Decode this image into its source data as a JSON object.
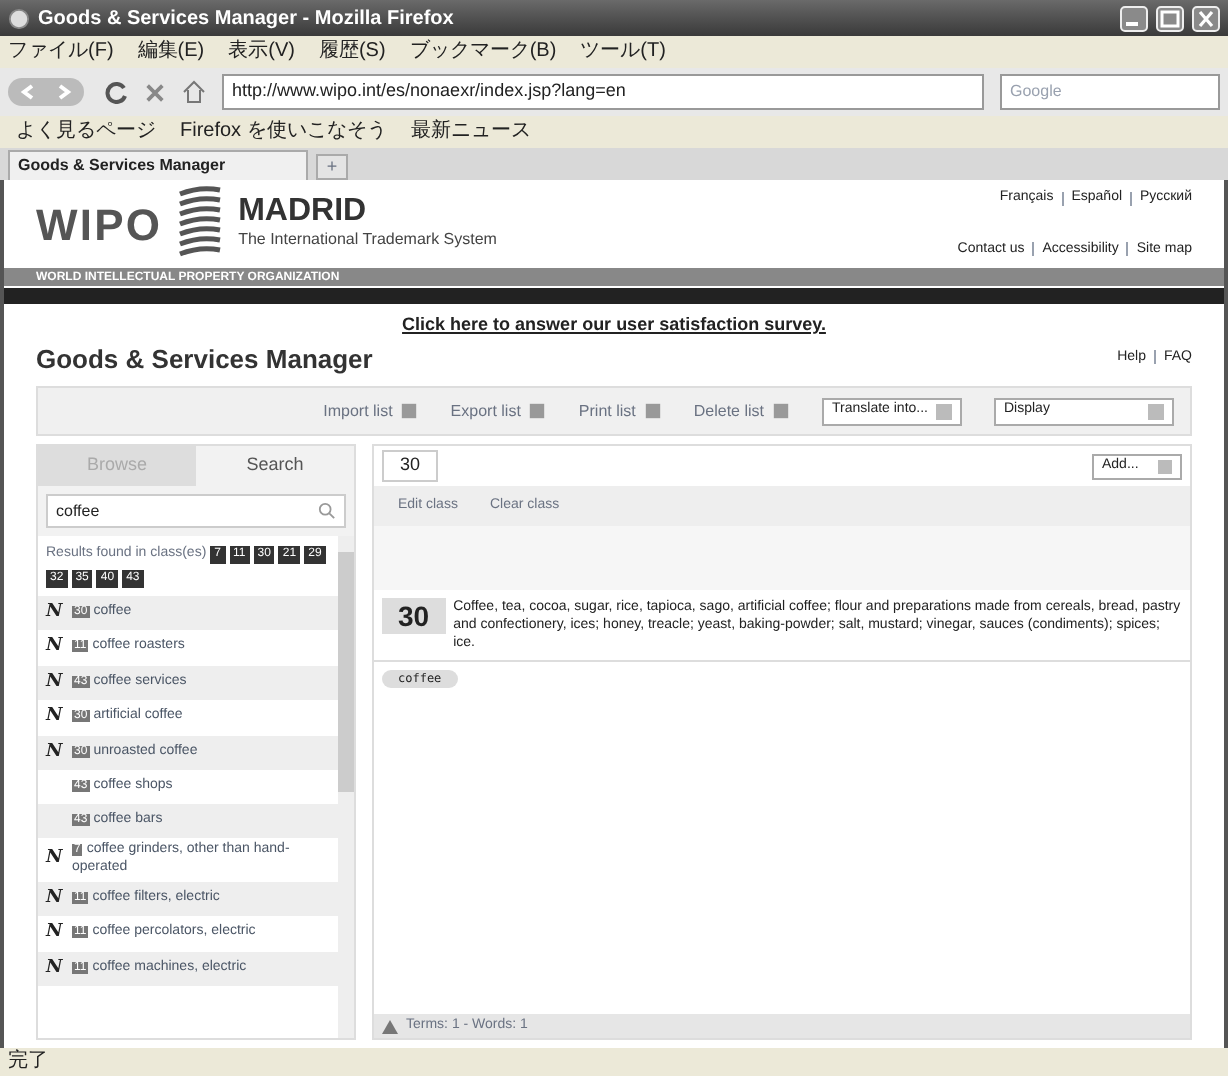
{
  "window": {
    "title": "Goods & Services Manager - Mozilla Firefox"
  },
  "menu": [
    "ファイル(F)",
    "編集(E)",
    "表示(V)",
    "履歴(S)",
    "ブックマーク(B)",
    "ツール(T)"
  ],
  "address": {
    "value": "http://www.wipo.int/es/nonaexr/index.jsp?lang=en"
  },
  "search_engine": {
    "placeholder": "Google"
  },
  "bookmarks": [
    "よく見るページ",
    "Firefox を使いこなそう",
    "最新ニュース"
  ],
  "tab": {
    "title": "Goods & Services Manager",
    "new_tab": "+"
  },
  "header": {
    "wipo": "WIPO",
    "madrid": "MADRID",
    "subtitle": "The International Trademark System",
    "org": "WORLD INTELLECTUAL PROPERTY ORGANIZATION",
    "languages": [
      "Français",
      "Español",
      "Русский"
    ],
    "links": [
      "Contact us",
      "Accessibility",
      "Site map"
    ]
  },
  "survey_link": "Click here to answer our user satisfaction survey.",
  "page_title": "Goods & Services Manager",
  "help_links": [
    "Help",
    "FAQ"
  ],
  "toolbar": {
    "actions": [
      "Import list",
      "Export list",
      "Print list",
      "Delete list"
    ],
    "translate": "Translate into...",
    "display": "Display"
  },
  "side_tabs": [
    {
      "label": "Browse",
      "selected": false
    },
    {
      "label": "Search",
      "selected": true
    }
  ],
  "search": {
    "value": "coffee"
  },
  "results_label": "Results found in class(es)",
  "result_classes": [
    "7",
    "11",
    "30",
    "21",
    "29",
    "32",
    "35",
    "40",
    "43"
  ],
  "results": [
    {
      "marker": "N",
      "class": "30",
      "term": "coffee"
    },
    {
      "marker": "N",
      "class": "11",
      "term": "coffee roasters"
    },
    {
      "marker": "N",
      "class": "43",
      "term": "coffee services"
    },
    {
      "marker": "N",
      "class": "30",
      "term": "artificial coffee"
    },
    {
      "marker": "N",
      "class": "30",
      "term": "unroasted coffee"
    },
    {
      "class": "43",
      "term": "coffee shops"
    },
    {
      "class": "43",
      "term": "coffee bars"
    },
    {
      "marker": "N",
      "class": "7",
      "term": "coffee grinders, other than hand-operated"
    },
    {
      "marker": "N",
      "class": "11",
      "term": "coffee filters, electric"
    },
    {
      "marker": "N",
      "class": "11",
      "term": "coffee percolators, electric"
    },
    {
      "marker": "N",
      "class": "11",
      "term": "coffee machines, electric"
    }
  ],
  "list_tab": "30",
  "add_select": "Add...",
  "edit_actions": [
    "Edit class",
    "Clear class"
  ],
  "class_entry": {
    "number": "30",
    "heading": "Coffee, tea, cocoa, sugar, rice, tapioca, sago, artificial coffee; flour and preparations made from cereals, bread, pastry and confectionery, ices; honey, treacle; yeast, baking-powder; salt, mustard; vinegar, sauces (condiments); spices; ice.",
    "terms": [
      "coffee"
    ]
  },
  "footer": "Terms: 1 - Words: 1",
  "status_bar": "完了"
}
